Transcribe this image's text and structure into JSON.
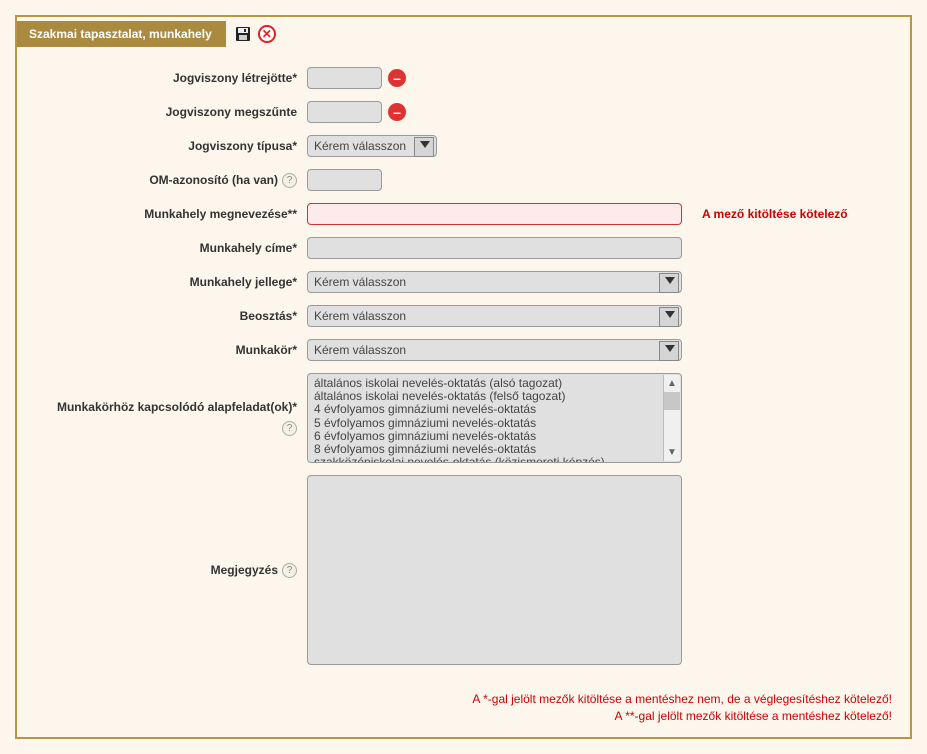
{
  "header": {
    "title": "Szakmai tapasztalat, munkahely"
  },
  "labels": {
    "jogviszony_letrejotte": "Jogviszony létrejötte*",
    "jogviszony_megszunte": "Jogviszony megszűnte",
    "jogviszony_tipusa": "Jogviszony típusa*",
    "om_azonosito": "OM-azonosító (ha van)",
    "munkahely_megnevezese": "Munkahely megnevezése**",
    "munkahely_cime": "Munkahely címe*",
    "munkahely_jellege": "Munkahely jellege*",
    "beosztas": "Beosztás*",
    "munkakor": "Munkakör*",
    "alapfeladat": "Munkakörhöz kapcsolódó alapfeladat(ok)*",
    "megjegyzes": "Megjegyzés"
  },
  "values": {
    "jogviszony_letrejotte": "",
    "jogviszony_megszunte": "",
    "om_azonosito": "",
    "munkahely_megnevezese": "",
    "munkahely_cime": "",
    "megjegyzes": ""
  },
  "selects": {
    "jogviszony_tipusa": "Kérem válasszon",
    "munkahely_jellege": "Kérem válasszon",
    "beosztas": "Kérem válasszon",
    "munkakor": "Kérem válasszon"
  },
  "listbox_items": [
    "általános iskolai nevelés-oktatás (alsó tagozat)",
    "általános iskolai nevelés-oktatás (felső tagozat)",
    "4 évfolyamos gimnáziumi nevelés-oktatás",
    "5 évfolyamos gimnáziumi nevelés-oktatás",
    "6 évfolyamos gimnáziumi nevelés-oktatás",
    "8 évfolyamos gimnáziumi nevelés-oktatás",
    "szakközépiskolai nevelés-oktatás (közismereti képzés)"
  ],
  "errors": {
    "munkahely_megnevezese": "A mező kitöltése kötelező"
  },
  "footnotes": {
    "line1": "A *-gal jelölt mezők kitöltése a mentéshez nem, de a véglegesítéshez kötelező!",
    "line2": "A **-gal jelölt mezők kitöltése a mentéshez kötelező!"
  }
}
